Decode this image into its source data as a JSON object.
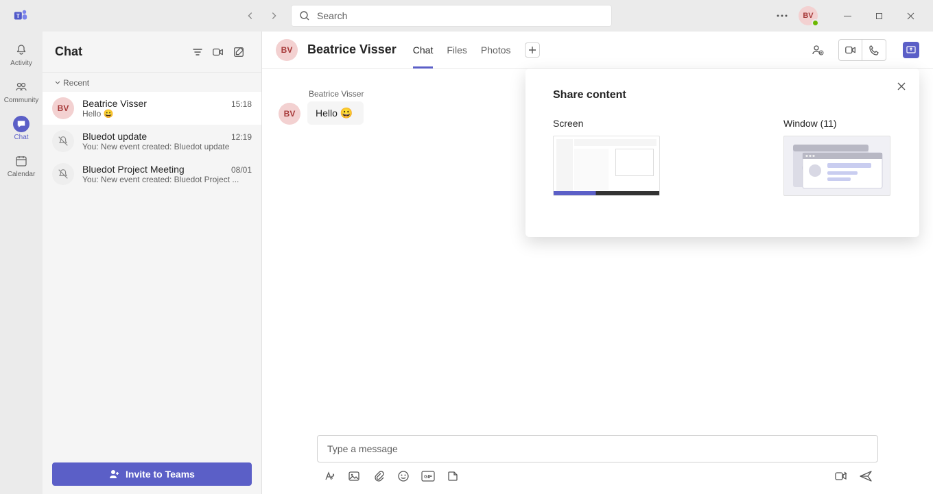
{
  "titlebar": {
    "search_placeholder": "Search",
    "avatar_initials": "BV"
  },
  "rail": {
    "activity": "Activity",
    "community": "Community",
    "chat": "Chat",
    "calendar": "Calendar"
  },
  "chatlist": {
    "title": "Chat",
    "section_recent": "Recent",
    "items": [
      {
        "initials": "BV",
        "title": "Beatrice Visser",
        "time": "15:18",
        "preview": "Hello 😀",
        "avatar_style": "pink"
      },
      {
        "title": "Bluedot update",
        "time": "12:19",
        "preview": "You: New event created: Bluedot update",
        "muted": true
      },
      {
        "title": "Bluedot Project Meeting",
        "time": "08/01",
        "preview": "You: New event created: Bluedot Project ...",
        "muted": true
      }
    ],
    "invite_label": "Invite to Teams"
  },
  "conversation": {
    "avatar_initials": "BV",
    "name": "Beatrice Visser",
    "tabs": {
      "chat": "Chat",
      "files": "Files",
      "photos": "Photos"
    },
    "message": {
      "sender": "Beatrice Visser",
      "avatar_initials": "BV",
      "text": "Hello",
      "emoji": "😀"
    },
    "composer_placeholder": "Type a message"
  },
  "share_popup": {
    "title": "Share content",
    "screen_label": "Screen",
    "window_label": "Window (11)"
  }
}
